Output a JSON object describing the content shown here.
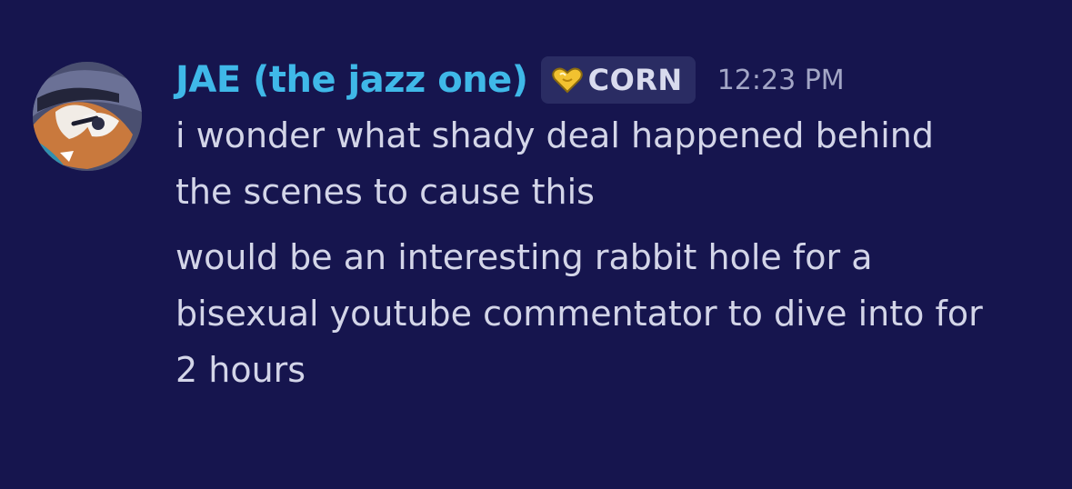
{
  "message": {
    "author": "JAE (the jazz one)",
    "author_color": "#3fb8e8",
    "tag": {
      "icon": "gold-heart-icon",
      "label": "CORN"
    },
    "timestamp": "12:23 PM",
    "lines_first": [
      "i wonder what shady deal happened behind",
      "the scenes to cause this"
    ],
    "lines_second": [
      "would be an interesting rabbit hole for a",
      "bisexual youtube commentator to dive into for",
      "2 hours"
    ]
  },
  "colors": {
    "background": "#16154e",
    "text": "#d3d5e8",
    "tag_background": "#2a2c63"
  }
}
